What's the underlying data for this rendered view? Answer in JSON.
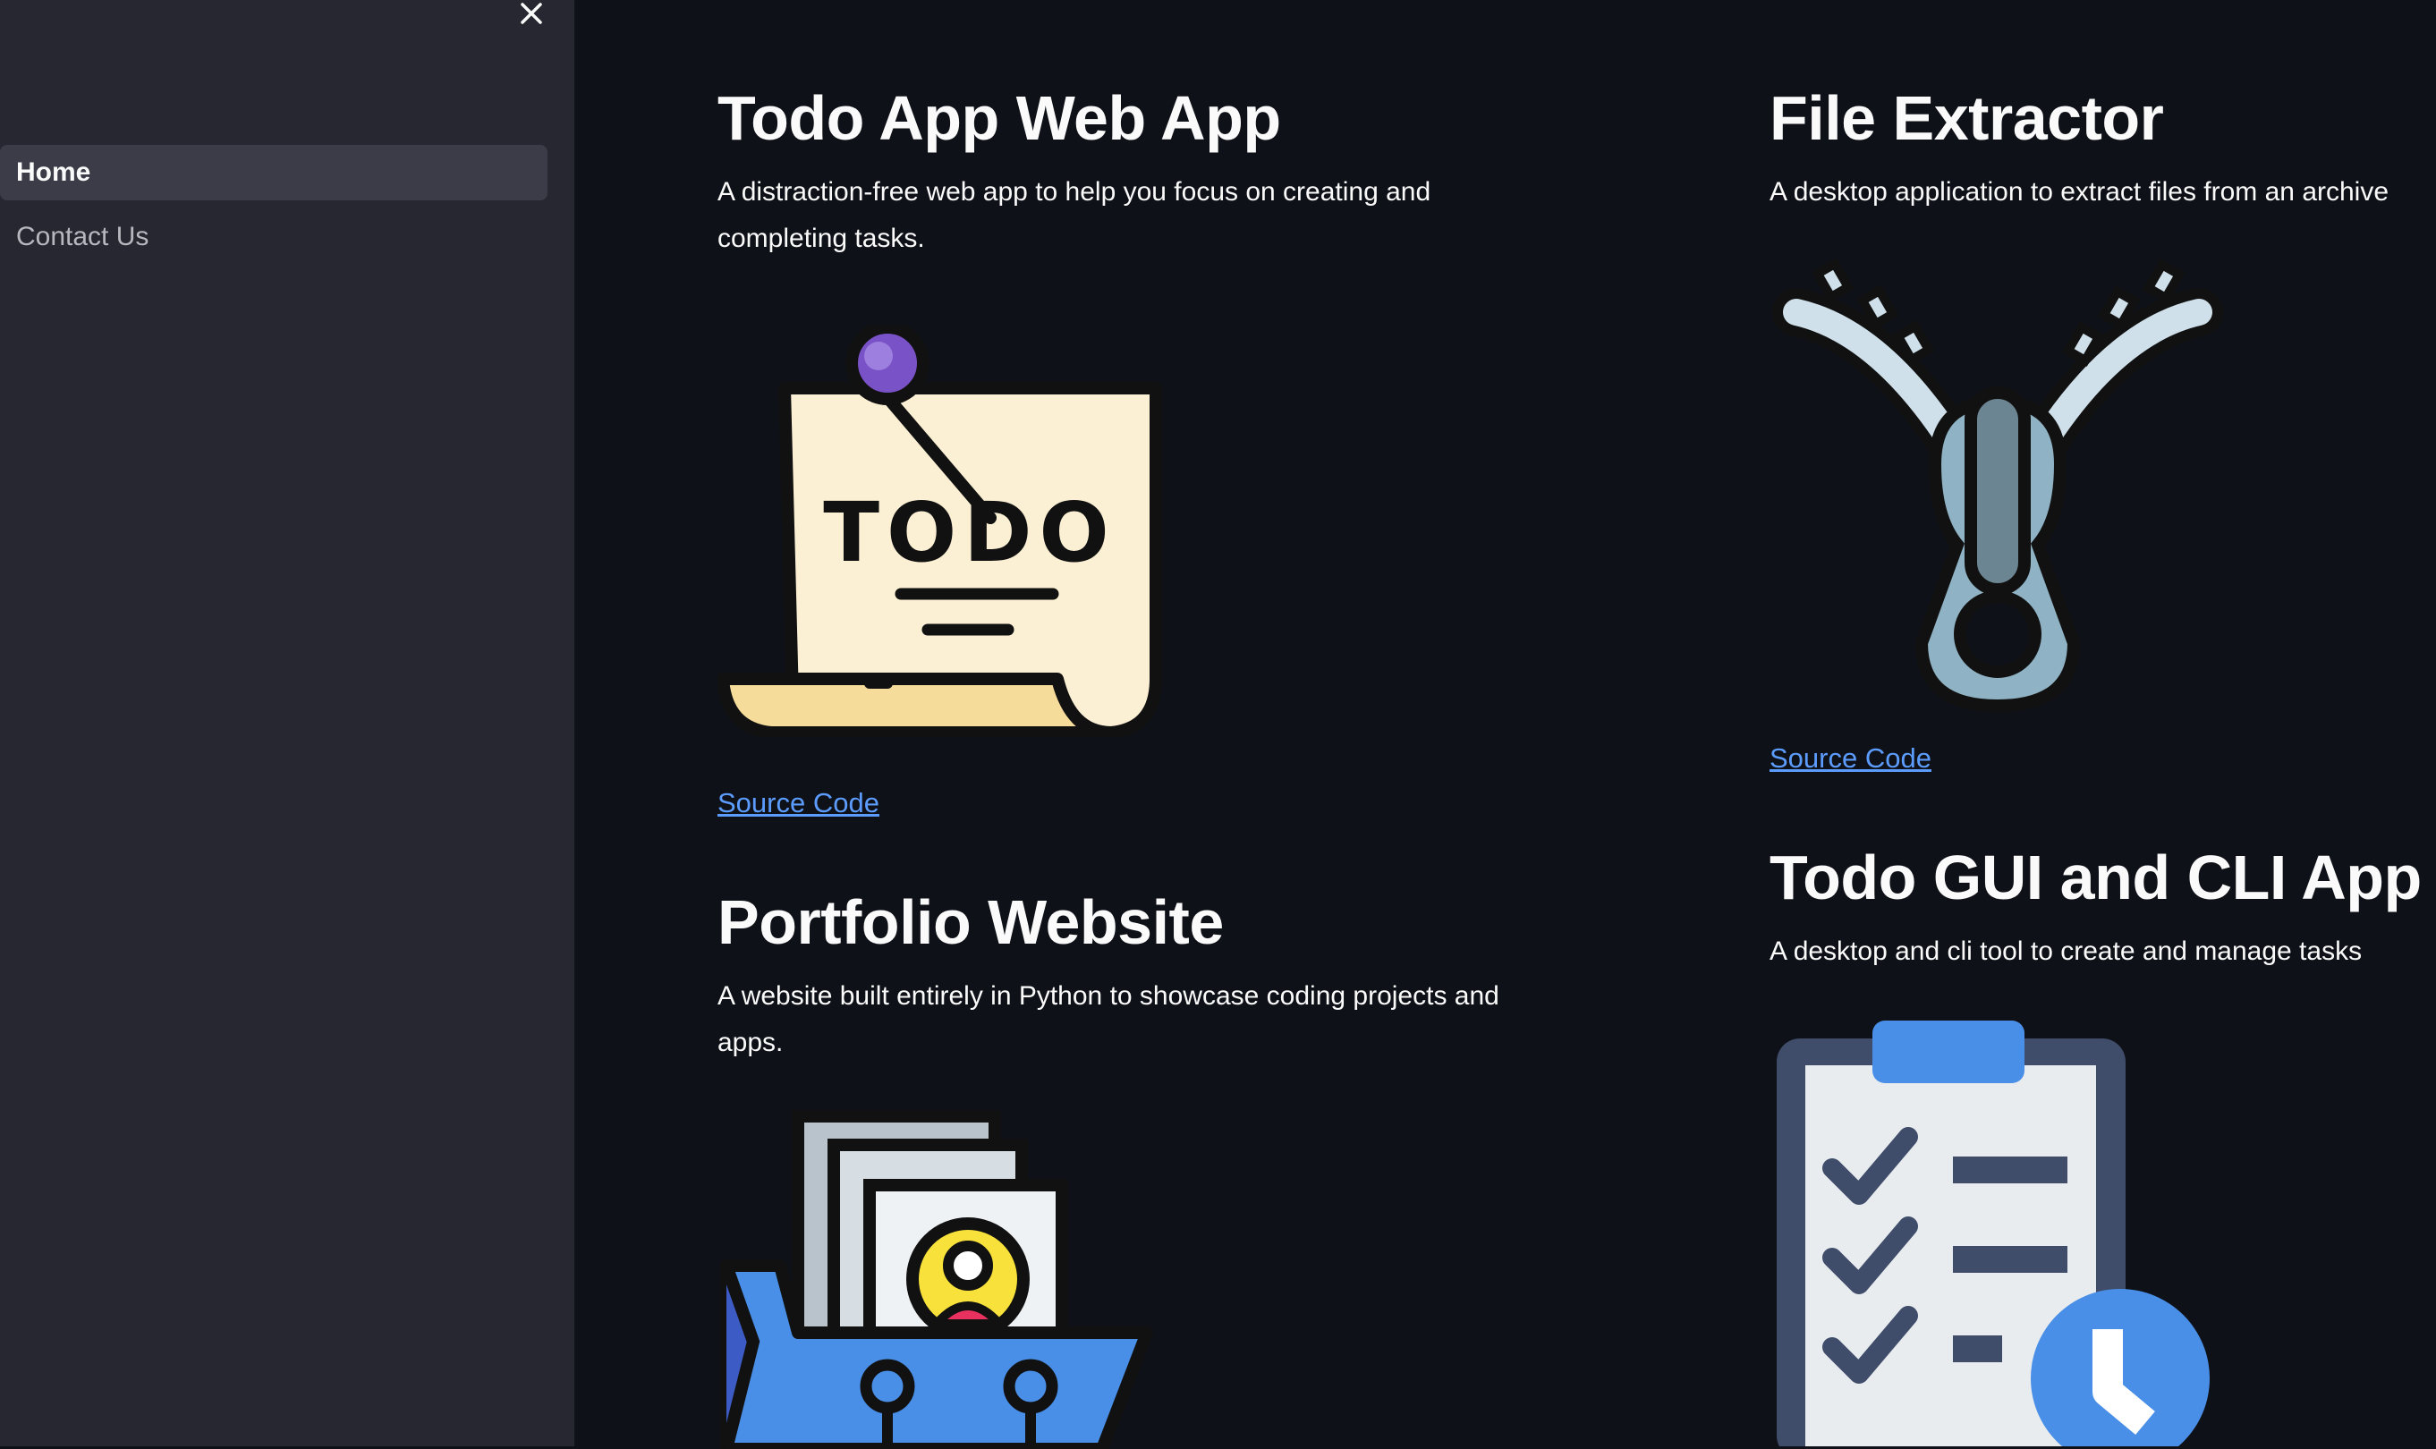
{
  "sidebar": {
    "close_icon": "close-icon",
    "items": [
      {
        "label": "Home",
        "active": true
      },
      {
        "label": "Contact Us",
        "active": false
      }
    ]
  },
  "projects": [
    {
      "title": "Todo App Web App",
      "description": "A distraction-free web app to help you focus on creating and completing tasks.",
      "image_icon": "todo-note-icon",
      "image_text": "TODO",
      "link_label": "Source Code"
    },
    {
      "title": "File Extractor",
      "description": "A desktop application to extract files from an archive",
      "image_icon": "zipper-icon",
      "link_label": "Source Code"
    },
    {
      "title": "Portfolio Website",
      "description": "A website built entirely in Python to showcase coding projects and apps.",
      "image_icon": "portfolio-folder-icon"
    },
    {
      "title": "Todo GUI and CLI App",
      "description": "A desktop and cli tool to create and manage tasks",
      "image_icon": "clipboard-checklist-icon"
    }
  ],
  "colors": {
    "background": "#0e1117",
    "sidebar": "#262730",
    "active_nav": "#3b3c47",
    "link": "#5c9cff"
  }
}
